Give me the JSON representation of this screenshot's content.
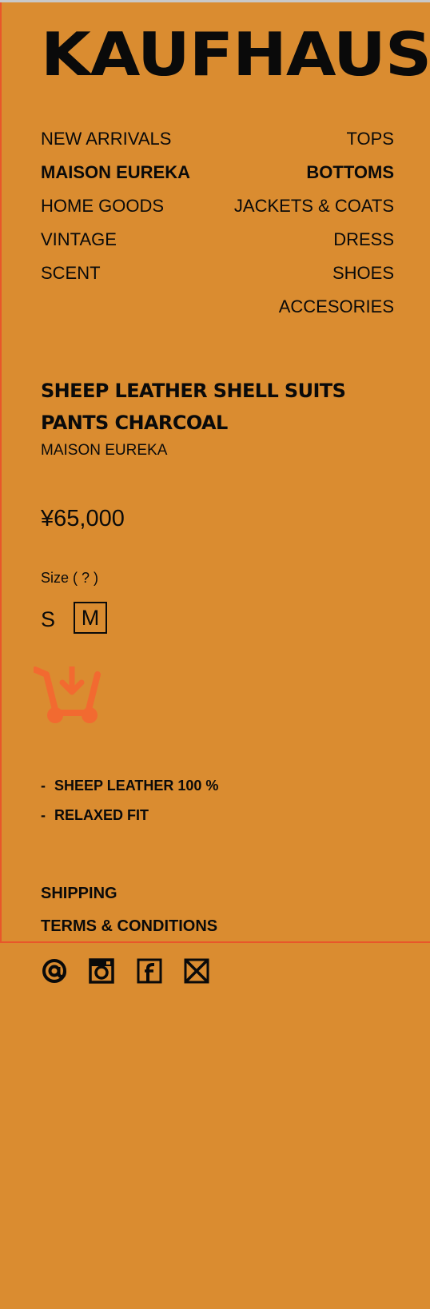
{
  "header": {
    "logo_text": "KAUFHAUS"
  },
  "nav": {
    "left": [
      "NEW ARRIVALS",
      "MAISON EUREKA",
      "HOME GOODS",
      "VINTAGE",
      "SCENT"
    ],
    "right": [
      "TOPS",
      "BOTTOMS",
      "JACKETS & COATS",
      "DRESS",
      "SHOES",
      "ACCESORIES"
    ]
  },
  "product": {
    "title": "SHEEP LEATHER SHELL SUITS PANTS CHARCOAL",
    "brand": "MAISON EUREKA",
    "price": "¥65,000",
    "size_label": "Size ( ? )",
    "sizes": [
      "S",
      "M"
    ],
    "selected_size": "M",
    "cart_icon": "cart-download-icon",
    "features": [
      "SHEEP LEATHER 100 %",
      "RELAXED FIT"
    ],
    "feature_bullet": "-"
  },
  "footer": {
    "links": [
      "SHIPPING",
      "TERMS & CONDITIONS"
    ],
    "social_icons": [
      "at-sign-icon",
      "instagram-icon",
      "facebook-icon",
      "mail-icon"
    ]
  },
  "colors": {
    "background": "#DA8C30",
    "accent": "#E8562A",
    "cart": "#F26A30",
    "text": "#0a0a0a"
  }
}
